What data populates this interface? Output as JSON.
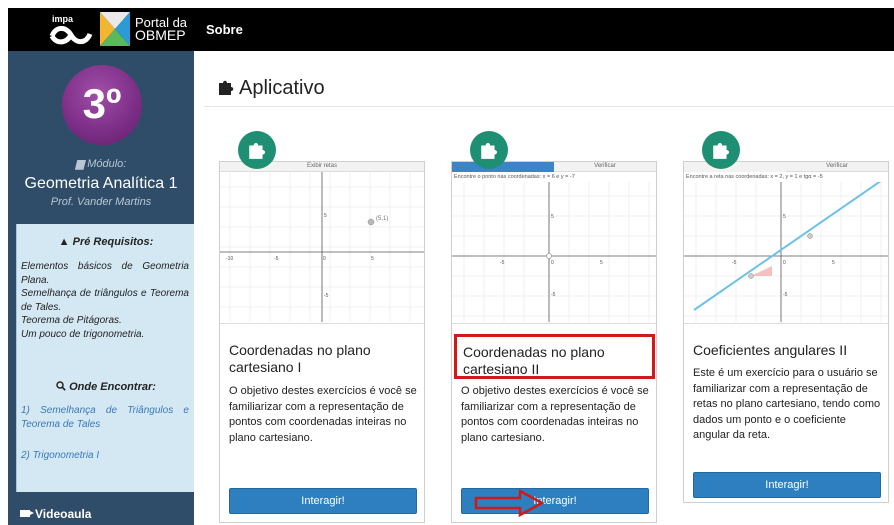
{
  "header": {
    "impa": "impa",
    "portal_line1": "Portal da",
    "portal_line2": "OBMEP",
    "nav_sobre": "Sobre"
  },
  "sidebar": {
    "badge": "3º",
    "modulo_label": "Módulo:",
    "modulo_title": "Geometria Analítica 1",
    "professor": "Prof. Vander Martins",
    "prereq_title": "Pré Requisitos:",
    "prereq_items": [
      "Elementos básicos de Geometria Plana.",
      "Semelhança de triângulos e Teorema de Tales.",
      "Teorema de Pitágoras.",
      "Um pouco de trigonometria."
    ],
    "onde_title": "Onde Encontrar:",
    "onde_items": [
      "1) Semelhança de Triângulos e Teorema de Tales",
      "2) Trigonometria I"
    ],
    "videoaula": "Videoaula"
  },
  "page": {
    "title": "Aplicativo"
  },
  "cards": [
    {
      "preview_header": "Exibir retas",
      "point_label": "(5,1)",
      "axis_ticks": [
        "-10",
        "-5",
        "0",
        "5",
        "10"
      ],
      "y_ticks": [
        "5",
        "-5"
      ],
      "title": "Coordenadas no plano cartesiano I",
      "description": "O objetivo destes exercícios é você se familiarizar com a representação de pontos com coordenadas inteiras no plano cartesiano.",
      "button": "Interagir!"
    },
    {
      "tab_right": "Verificar",
      "instruction": "Encontre o ponto nas coordenadas: x = 6 e y = -7",
      "axis_ticks": [
        "-5",
        "0",
        "5"
      ],
      "y_ticks": [
        "5",
        "-5"
      ],
      "title": "Coordenadas no plano cartesiano II",
      "description": "O objetivo destes exercícios é você se familiarizar com a representação de pontos com coordenadas inteiras no plano cartesiano.",
      "button": "Interagir!"
    },
    {
      "tab_right": "Verificar",
      "instruction": "Encontre a reta nas coordenadas: x = 2, y = 1 e tgα = -5",
      "axis_ticks": [
        "-5",
        "0",
        "5"
      ],
      "y_ticks": [
        "5",
        "-5"
      ],
      "title": "Coeficientes angulares II",
      "description": "Este é um exercício para o usuário se familiarizar com a representação de retas no plano cartesiano, tendo como dados um ponto e o coeficiente angular da reta.",
      "button": "Interagir!"
    }
  ],
  "colors": {
    "accent_green": "#1e8f72",
    "button_blue": "#2d7fc0",
    "sidebar_bg": "#2f4d69",
    "highlight_red": "#d01a1a"
  }
}
